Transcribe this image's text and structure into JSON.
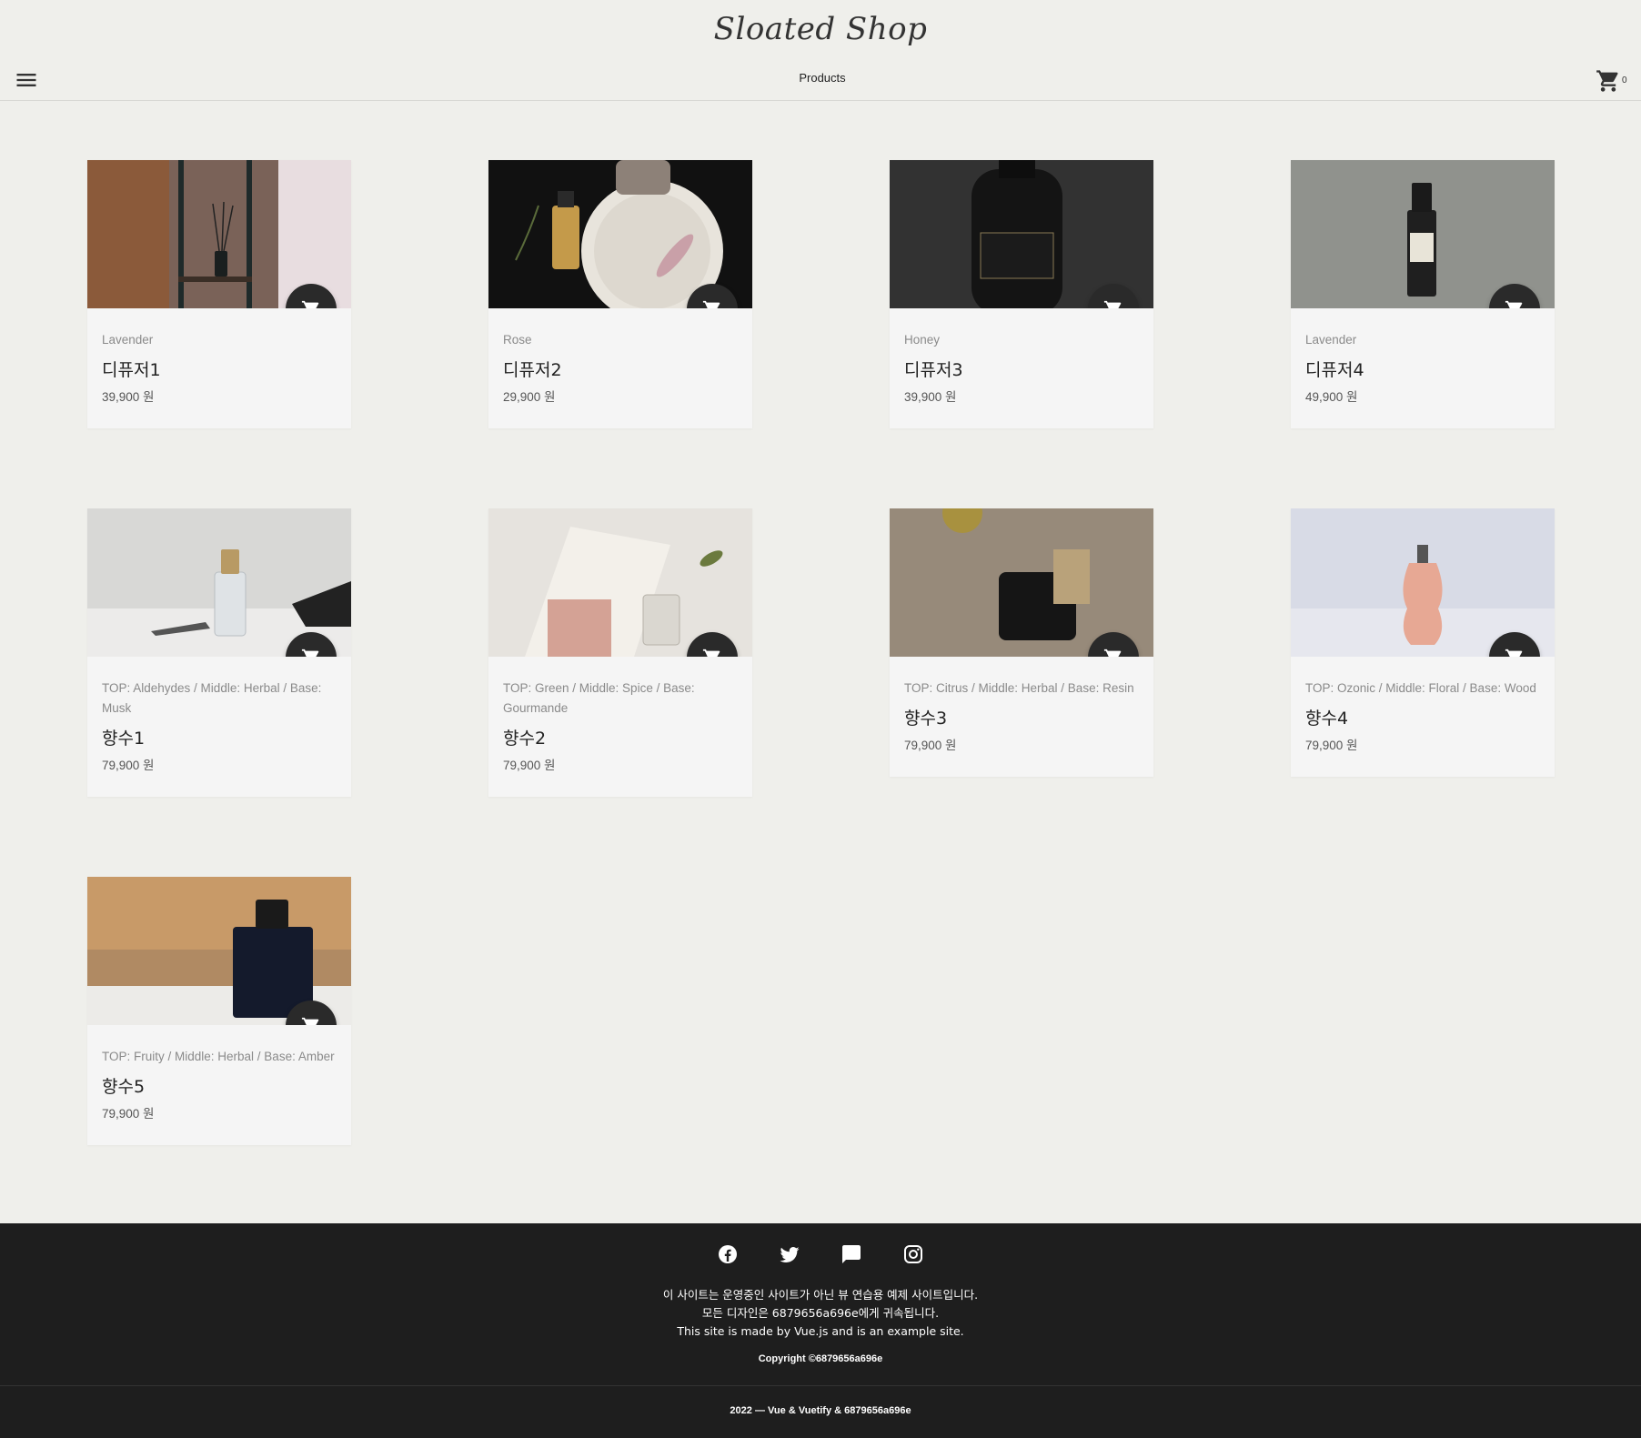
{
  "header": {
    "logo": "Sloated Shop",
    "nav_products": "Products",
    "cart_count": "0"
  },
  "products": [
    {
      "sub": "Lavender",
      "name": "디퓨저1",
      "price": "39,900 원"
    },
    {
      "sub": "Rose",
      "name": "디퓨저2",
      "price": "29,900 원"
    },
    {
      "sub": "Honey",
      "name": "디퓨저3",
      "price": "39,900 원"
    },
    {
      "sub": "Lavender",
      "name": "디퓨저4",
      "price": "49,900 원"
    },
    {
      "sub": "TOP: Aldehydes / Middle: Herbal / Base: Musk",
      "name": "향수1",
      "price": "79,900 원"
    },
    {
      "sub": "TOP: Green / Middle: Spice / Base: Gourmande",
      "name": "향수2",
      "price": "79,900 원"
    },
    {
      "sub": "TOP: Citrus / Middle: Herbal / Base: Resin",
      "name": "향수3",
      "price": "79,900 원"
    },
    {
      "sub": "TOP: Ozonic / Middle: Floral / Base: Wood",
      "name": "향수4",
      "price": "79,900 원"
    },
    {
      "sub": "TOP: Fruity / Middle: Herbal / Base: Amber",
      "name": "향수5",
      "price": "79,900 원"
    }
  ],
  "footer": {
    "line1": "이 사이트는 운영중인 사이트가 아닌 뷰 연습용 예제 사이트입니다.",
    "line2": "모든 디자인은 6879656a696e에게 귀속됩니다.",
    "line3": "This site is made by Vue.js and is an example site.",
    "copyright": "Copyright ©6879656a696e",
    "bottom": "2022 — Vue & Vuetify & 6879656a696e"
  },
  "icons": {
    "menu": "menu-icon",
    "cart": "cart-icon",
    "facebook": "facebook-icon",
    "twitter": "twitter-icon",
    "chat": "chat-icon",
    "instagram": "instagram-icon"
  },
  "colors": {
    "background": "#efefeb",
    "card": "#f5f5f5",
    "fab": "#2a2a2a",
    "footer": "#1e1e1e"
  }
}
